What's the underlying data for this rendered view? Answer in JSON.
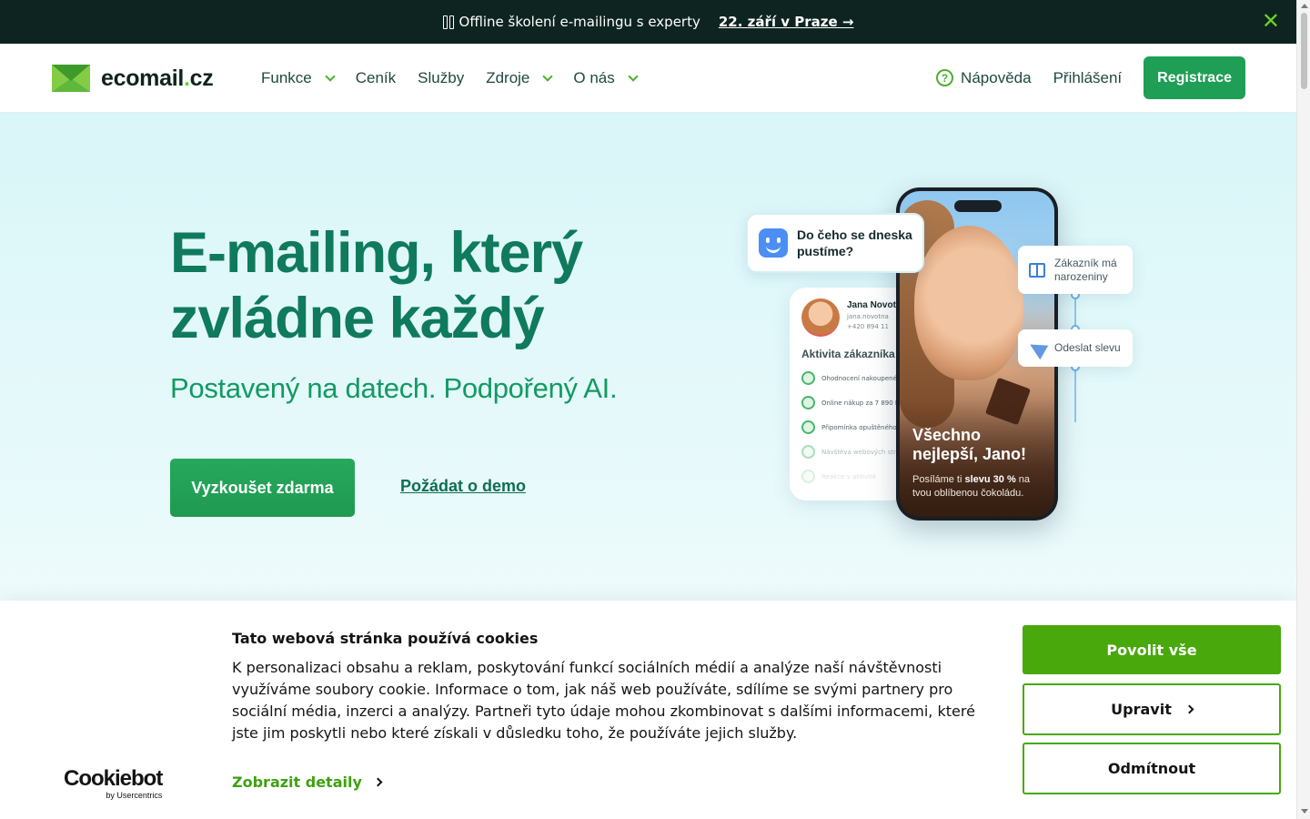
{
  "announcement": {
    "text": "Offline školení e-mailingu s experty",
    "link_label": "22. září v Praze →",
    "close_icon": "close-icon"
  },
  "header": {
    "logo_main": "ecomail",
    "logo_dot": ".",
    "logo_tld": "cz",
    "nav": [
      {
        "label": "Funkce",
        "has_dropdown": true
      },
      {
        "label": "Ceník",
        "has_dropdown": false
      },
      {
        "label": "Služby",
        "has_dropdown": false
      },
      {
        "label": "Zdroje",
        "has_dropdown": true
      },
      {
        "label": "O nás",
        "has_dropdown": true
      }
    ],
    "help_label": "Nápověda",
    "help_icon_glyph": "?",
    "login_label": "Přihlášení",
    "register_label": "Registrace"
  },
  "hero": {
    "title": "E-mailing, který zvládne každý",
    "subtitle": "Postavený na datech. Podpořený AI.",
    "cta_primary": "Vyzkoušet zdarma",
    "cta_secondary": "Požádat o demo"
  },
  "illustration": {
    "chat_text": "Do čeho se dneska pustíme?",
    "profile": {
      "name": "Jana Novot",
      "email": "jana.novotna",
      "phone": "+420 894 11",
      "section": "Aktivita zákazníka",
      "activities": [
        "Ohodnocení nakoupené",
        "Online nákup za 7 890 K",
        "Připomínka opuštěného",
        "Návštěva webových str",
        "Reakce v aktivitě"
      ]
    },
    "phone": {
      "headline": "Všechno nejlepší, Jano!",
      "body_prefix": "Posíláme ti ",
      "body_bold": "slevu 30 %",
      "body_suffix": " na tvou oblíbenou čokoládu."
    },
    "flow": [
      {
        "label": "Zákazník má narozeniny",
        "icon": "gift-icon"
      },
      {
        "label": "Odeslat slevu",
        "icon": "send-icon"
      }
    ]
  },
  "cookie_banner": {
    "title": "Tato webová stránka používá cookies",
    "text": "K personalizaci obsahu a reklam, poskytování funkcí sociálních médií a analýze naší návštěvnosti využíváme soubory cookie. Informace o tom, jak náš web používáte, sdílíme se svými partnery pro sociální média, inzerci a analýzy. Partneři tyto údaje mohou zkombinovat s dalšími informacemi, které jste jim poskytli nebo které získali v důsledku toho, že používáte jejich služby.",
    "details_label": "Zobrazit detaily",
    "allow_label": "Povolit vše",
    "edit_label": "Upravit",
    "deny_label": "Odmítnout",
    "brand": "Cookiebot",
    "brand_by": "by Usercentrics"
  },
  "colors": {
    "brand_green": "#1f9e55",
    "dark_bar": "#0d2420",
    "hero_title": "#0f7a5c",
    "cookie_green": "#48a80c"
  }
}
